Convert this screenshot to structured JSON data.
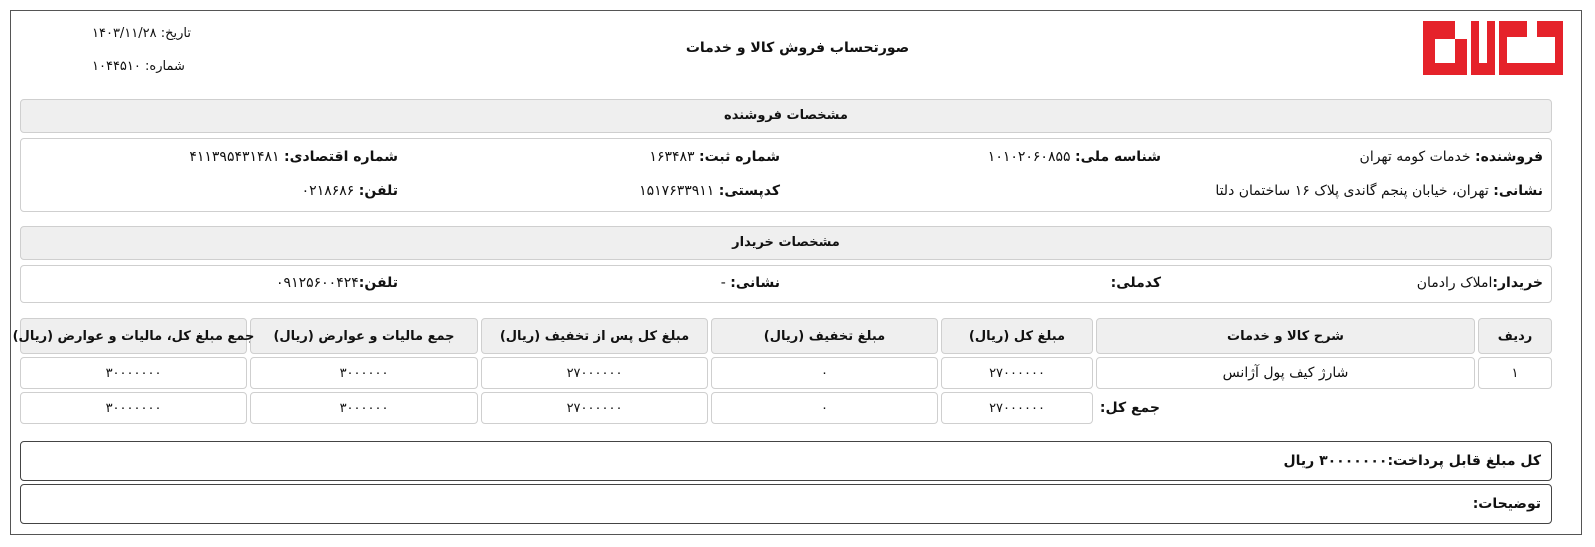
{
  "header": {
    "title": "صورتحساب فروش کالا و خدمات",
    "date_label": "تاریخ:",
    "date_value": "۱۴۰۳/۱۱/۲۸",
    "number_label": "شماره:",
    "number_value": "۱۰۴۴۵۱۰",
    "logo_text": "دلتا",
    "logo_color": "#e5222a"
  },
  "seller": {
    "section_title": "مشخصات فروشنده",
    "name_label": "فروشنده:",
    "name_value": "خدمات کومه تهران",
    "national_id_label": "شناسه ملی:",
    "national_id_value": "۱۰۱۰۲۰۶۰۸۵۵",
    "reg_label": "شماره ثبت:",
    "reg_value": "۱۶۳۴۸۳",
    "eco_label": "شماره اقتصادی:",
    "eco_value": "۴۱۱۳۹۵۴۳۱۴۸۱",
    "address_label": "نشانی:",
    "address_value": "تهران، خیابان پنجم گاندی پلاک ۱۶ ساختمان دلتا",
    "postal_label": "کدپستی:",
    "postal_value": "۱۵۱۷۶۳۳۹۱۱",
    "phone_label": "تلفن:",
    "phone_value": "۰۲۱۸۶۸۶"
  },
  "buyer": {
    "section_title": "مشخصات خریدار",
    "name_label": "خریدار:",
    "name_value": "املاک رادمان",
    "national_code_label": "کدملی:",
    "national_code_value": "",
    "address_label": "نشانی:",
    "address_value": "-",
    "phone_label": "تلفن:",
    "phone_value": "۰۹۱۲۵۶۰۰۴۲۴"
  },
  "table": {
    "headers": [
      "ردیف",
      "شرح کالا و خدمات",
      "مبلغ کل (ریال)",
      "مبلغ تخفیف (ریال)",
      "مبلغ کل پس از تخفیف (ریال)",
      "جمع مالیات و عوارض (ریال)",
      "جمع مبلغ کل، مالیات و عوارض (ریال)"
    ],
    "rows": [
      [
        "۱",
        "شارژ کیف پول آژانس",
        "۲۷۰۰۰۰۰۰",
        "۰",
        "۲۷۰۰۰۰۰۰",
        "۳۰۰۰۰۰۰",
        "۳۰۰۰۰۰۰۰"
      ]
    ],
    "total_label": "جمع کل:",
    "totals": [
      "۲۷۰۰۰۰۰۰",
      "۰",
      "۲۷۰۰۰۰۰۰",
      "۳۰۰۰۰۰۰",
      "۳۰۰۰۰۰۰۰"
    ]
  },
  "payable": {
    "label": "کل مبلغ قابل پرداخت:",
    "value": "۳۰۰۰۰۰۰۰ ریال"
  },
  "notes": {
    "label": "توضیحات:"
  }
}
